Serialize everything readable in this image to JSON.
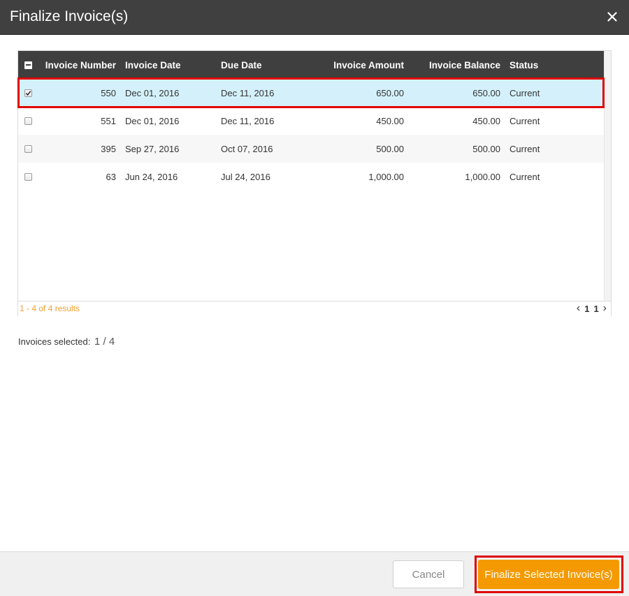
{
  "dialog": {
    "title": "Finalize Invoice(s)",
    "close_icon": "close-icon"
  },
  "table": {
    "columns": [
      "Invoice Number",
      "Invoice Date",
      "Due Date",
      "Invoice Amount",
      "Invoice Balance",
      "Status"
    ],
    "rows": [
      {
        "selected": true,
        "number": "550",
        "invoice_date": "Dec 01, 2016",
        "due_date": "Dec 11, 2016",
        "amount": "650.00",
        "balance": "650.00",
        "status": "Current"
      },
      {
        "selected": false,
        "number": "551",
        "invoice_date": "Dec 01, 2016",
        "due_date": "Dec 11, 2016",
        "amount": "450.00",
        "balance": "450.00",
        "status": "Current"
      },
      {
        "selected": false,
        "number": "395",
        "invoice_date": "Sep 27, 2016",
        "due_date": "Oct 07, 2016",
        "amount": "500.00",
        "balance": "500.00",
        "status": "Current"
      },
      {
        "selected": false,
        "number": "63",
        "invoice_date": "Jun 24, 2016",
        "due_date": "Jul 24, 2016",
        "amount": "1,000.00",
        "balance": "1,000.00",
        "status": "Current"
      }
    ],
    "results_text": "1 - 4 of 4 results",
    "pager": {
      "current_page": "1",
      "total_pages": "1"
    }
  },
  "selection": {
    "label": "Invoices selected:",
    "count": "1 / 4"
  },
  "footer": {
    "cancel_label": "Cancel",
    "finalize_label": "Finalize Selected Invoice(s)"
  },
  "colors": {
    "titlebar": "#404040",
    "header": "#3f3f3f",
    "selected_row": "#d4f1fb",
    "accent": "#f49a00",
    "highlight": "#e00000"
  }
}
